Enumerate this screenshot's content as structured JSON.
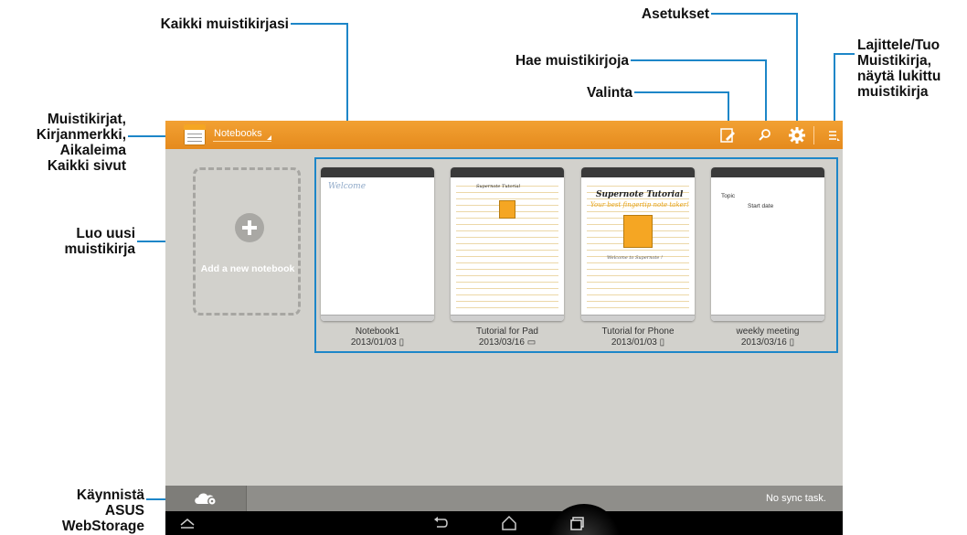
{
  "callouts": {
    "kaikki_muistikirjasi": "Kaikki muistikirjasi",
    "asetukset": "Asetukset",
    "hae": "Hae muistikirjoja",
    "valinta": "Valinta",
    "lajittele": "Lajittele/Tuo\nMuistikirja,\nnäytä lukittu\nmuistikirja",
    "muistikirjat": "Muistikirjat,\nKirjanmerkki,\nAikaleima\nKaikki sivut",
    "luo_uusi": "Luo uusi\nmuistikirja",
    "kaynnista": "Käynnistä\nASUS\nWebStorage"
  },
  "actionbar": {
    "dropdown_label": "Notebooks",
    "icons": [
      "select-edit-icon",
      "search-icon",
      "settings-gear-icon",
      "sort-menu-icon"
    ]
  },
  "add_notebook": {
    "label": "Add a new notebook"
  },
  "notebooks": [
    {
      "title": "Notebook1",
      "date": "2013/01/03"
    },
    {
      "title": "Tutorial for Pad",
      "date": "2013/03/16"
    },
    {
      "title": "Tutorial for Phone",
      "date": "2013/01/03"
    },
    {
      "title": "weekly meeting",
      "date": "2013/03/16"
    }
  ],
  "previews": {
    "nb1_text": "Welcome",
    "pad_title": "Supernote Tutorial",
    "phone_title": "Supernote Tutorial",
    "phone_sub": "Your best fingertip note taker!",
    "phone_welcome": "Welcome to Supernote !",
    "meeting_topic": "Topic",
    "meeting_start": "Start date"
  },
  "status": {
    "sync_text": "No sync task."
  },
  "colors": {
    "accent": "#e58a1d",
    "callout_line": "#1d86c8"
  }
}
